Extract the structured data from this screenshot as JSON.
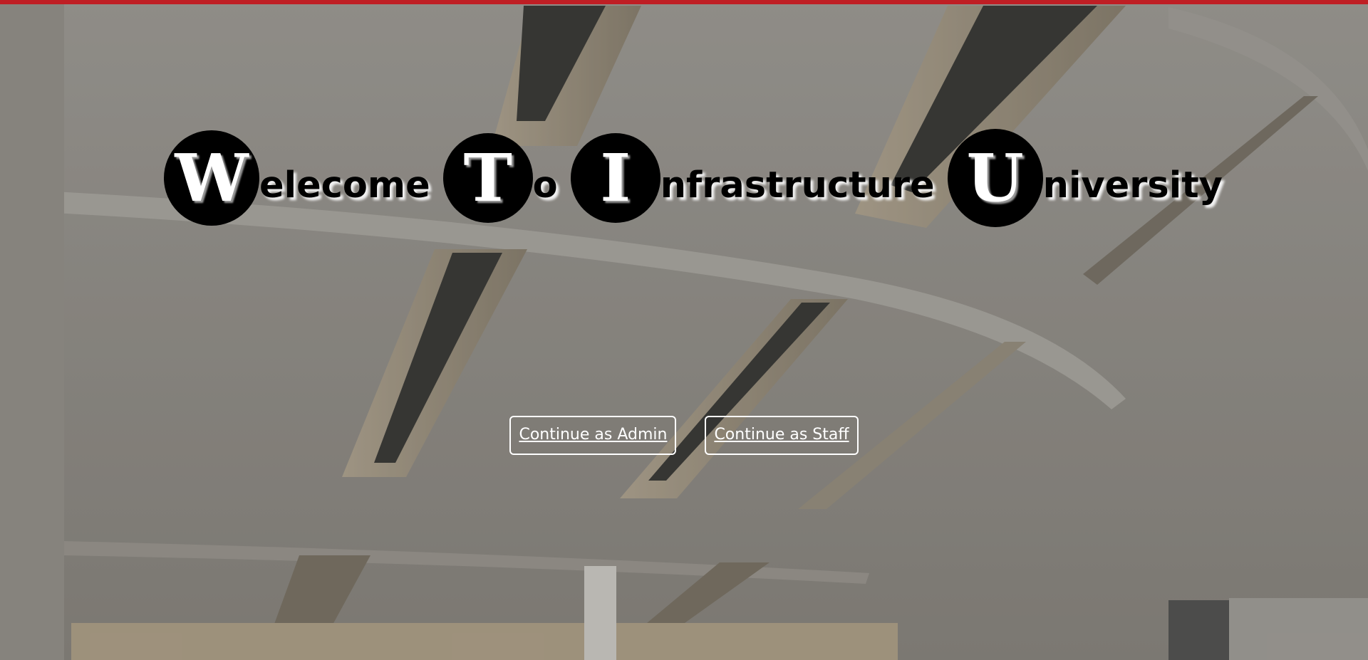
{
  "page": {
    "accent_color": "#bf1e24"
  },
  "title": {
    "words": [
      {
        "initial": "W",
        "rest": "elecome"
      },
      {
        "initial": "T",
        "rest": "o"
      },
      {
        "initial": "I",
        "rest": "nfrastructure"
      },
      {
        "initial": "U",
        "rest": "niversity"
      }
    ]
  },
  "actions": {
    "admin_label": "Continue as Admin",
    "staff_label": "Continue as Staff"
  }
}
